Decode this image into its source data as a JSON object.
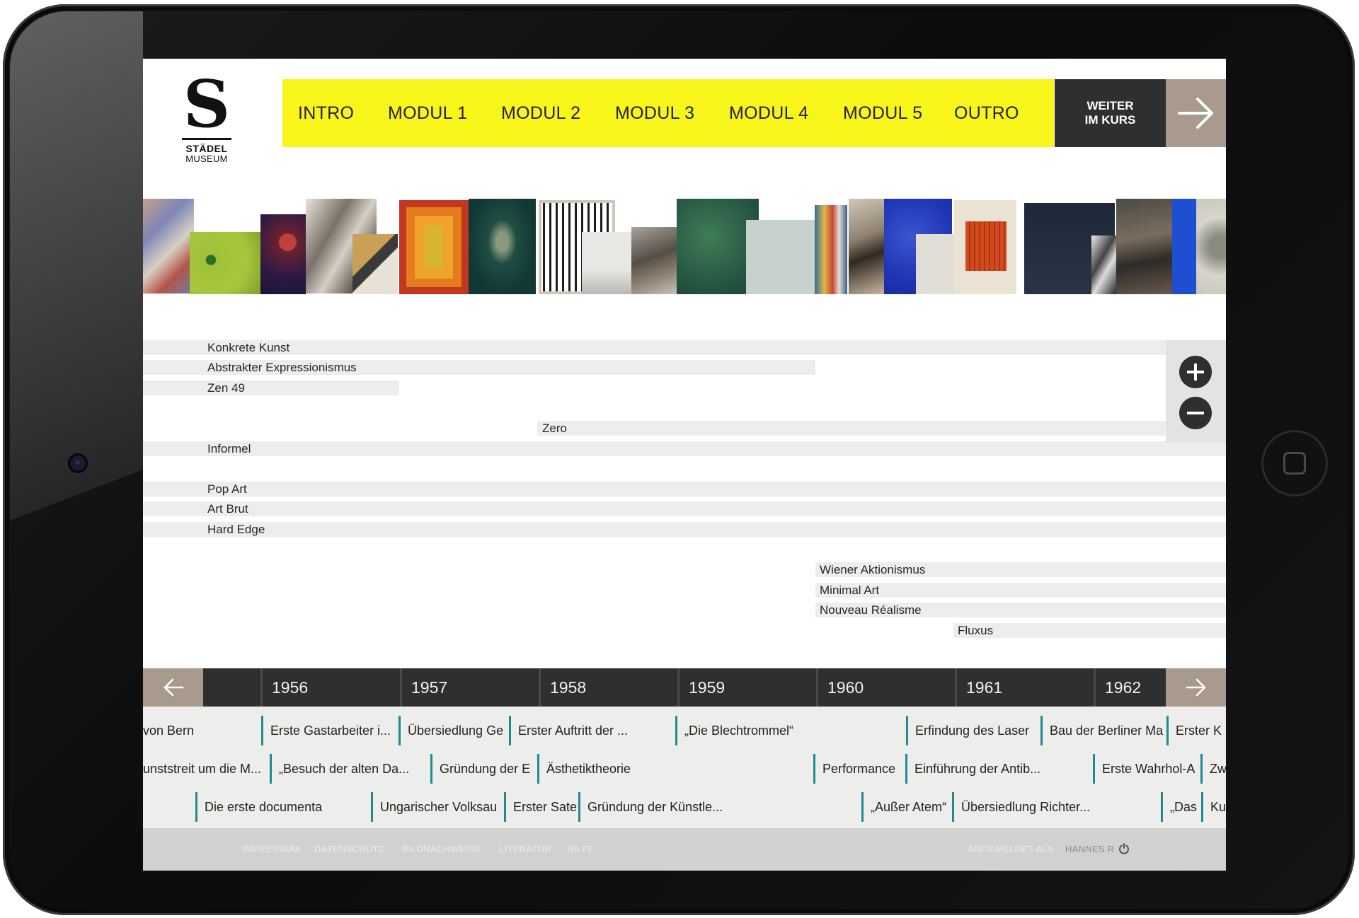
{
  "logo": {
    "letter": "S",
    "line1": "STÄDEL",
    "line2": "MUSEUM"
  },
  "nav": {
    "items": [
      "INTRO",
      "MODUL 1",
      "MODUL 2",
      "MODUL 3",
      "MODUL 4",
      "MODUL 5",
      "OUTRO"
    ],
    "cta_line1": "WEITER",
    "cta_line2": "IM KURS",
    "cta_icon": "arrow-right-icon"
  },
  "movements": [
    "Konkrete Kunst",
    "Abstrakter Expressionismus",
    "Zen 49",
    "Zero",
    "Informel",
    "Pop Art",
    "Art Brut",
    "Hard Edge",
    "Wiener Aktionismus",
    "Minimal Art",
    "Nouveau Réalisme",
    "Fluxus"
  ],
  "zoom": {
    "in_icon": "plus-icon",
    "out_icon": "minus-icon"
  },
  "timeline": {
    "years": [
      "1956",
      "1957",
      "1958",
      "1959",
      "1960",
      "1961",
      "1962"
    ],
    "prev_icon": "arrow-left-icon",
    "next_icon": "arrow-right-icon"
  },
  "events": [
    "von Bern",
    "Erste Gastarbeiter i...",
    "Übersiedlung Ge",
    "Erster Auftritt der ...",
    "„Die Blechtrommel“",
    "Erfindung des Laser",
    "Bau der Berliner Ma",
    "Erster K",
    "unststreit um die M...",
    "„Besuch der alten Da...",
    "Gründung der E",
    "Ästhetiktheorie",
    "Performance",
    "Einführung der Antib...",
    "Erste Wahrhol-A",
    "Zw",
    "Die erste documenta",
    "Ungarischer Volksau",
    "Erster Sate",
    "Gründung der Künstle...",
    "„Außer Atem“",
    "Übersiedlung Richter...",
    "„Das",
    "Ku"
  ],
  "footer": {
    "links": [
      "IMPRESSUM",
      "DATENSCHUTZ",
      "BILDNACHWEISE",
      "LITERATUR",
      "HILFE"
    ],
    "logged_in_label": "ANGEMELDET ALS",
    "user": "HANNES R",
    "logout_icon": "power-icon"
  },
  "colors": {
    "accent": "#f8f51b",
    "dark": "#2f2f30",
    "taupe": "#a89a8d",
    "event_marker": "#1e8a96"
  }
}
